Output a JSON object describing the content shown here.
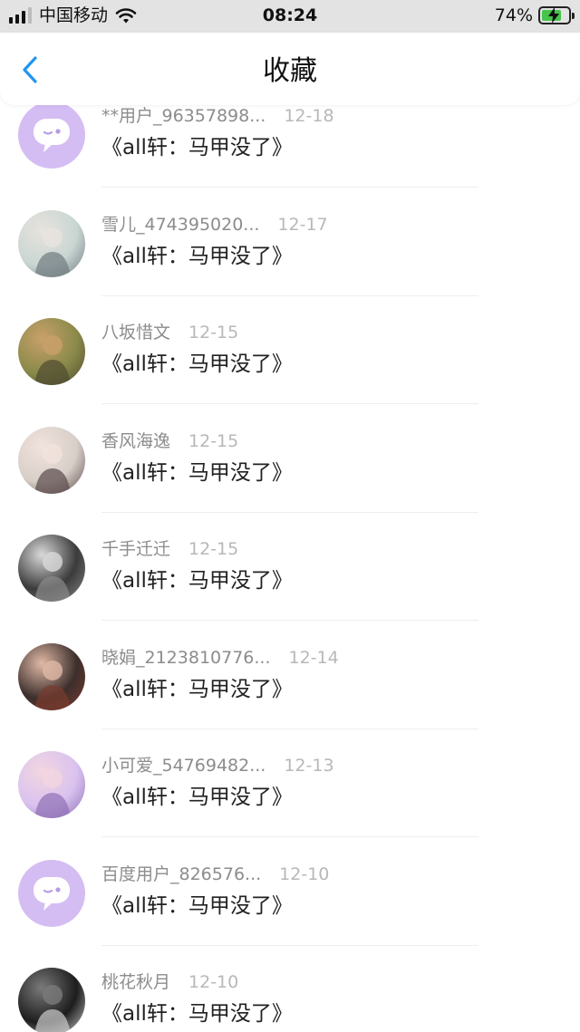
{
  "status_bar": {
    "carrier": "中国移动",
    "time": "08:24",
    "battery_percent": "74%",
    "battery_level": 0.74,
    "icons": [
      "signal-icon",
      "wifi-icon",
      "battery-charging-icon"
    ]
  },
  "navbar": {
    "title": "收藏",
    "back_icon": "chevron-left-icon"
  },
  "colors": {
    "accent": "#2196f3",
    "avatar_default": "#d4bdf3",
    "battery_fill": "#45c54b"
  },
  "favorites": [
    {
      "username": "**用户_96357898...",
      "date": "12-18",
      "title": "《all轩：马甲没了》",
      "avatar": "default-chat-avatar"
    },
    {
      "username": "雪儿_474395020...",
      "date": "12-17",
      "title": "《all轩：马甲没了》",
      "avatar": "photo-avatar"
    },
    {
      "username": "八坂惜文",
      "date": "12-15",
      "title": "《all轩：马甲没了》",
      "avatar": "photo-avatar"
    },
    {
      "username": "香风海逸",
      "date": "12-15",
      "title": "《all轩：马甲没了》",
      "avatar": "photo-avatar"
    },
    {
      "username": "千手迁迁",
      "date": "12-15",
      "title": "《all轩：马甲没了》",
      "avatar": "dog-photo-avatar"
    },
    {
      "username": "晓娟_2123810776...",
      "date": "12-14",
      "title": "《all轩：马甲没了》",
      "avatar": "illustration-avatar"
    },
    {
      "username": "小可爱_54769482...",
      "date": "12-13",
      "title": "《all轩：马甲没了》",
      "avatar": "illustration-avatar"
    },
    {
      "username": "百度用户_826576...",
      "date": "12-10",
      "title": "《all轩：马甲没了》",
      "avatar": "default-chat-avatar"
    },
    {
      "username": "桃花秋月",
      "date": "12-10",
      "title": "《all轩：马甲没了》",
      "avatar": "photo-avatar"
    }
  ]
}
